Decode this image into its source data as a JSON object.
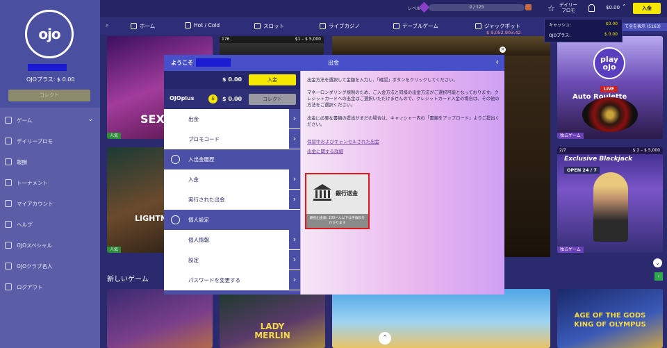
{
  "sidebar": {
    "logo": "ojo",
    "ojo_plus": "OJOプラス: $ 0.00",
    "collect": "コレクト",
    "items": [
      {
        "label": "ゲーム",
        "icon": "gamepad-icon"
      },
      {
        "label": "デイリープロモ",
        "icon": "star-icon"
      },
      {
        "label": "報酬",
        "icon": "gift-icon"
      },
      {
        "label": "トーナメント",
        "icon": "trophy-icon"
      },
      {
        "label": "マイアカウント",
        "icon": "user-icon"
      },
      {
        "label": "ヘルプ",
        "icon": "help-icon"
      },
      {
        "label": "OJOスペシャル",
        "icon": "special-icon"
      },
      {
        "label": "OJOクラブ名人",
        "icon": "crown-icon"
      },
      {
        "label": "ログアウト",
        "icon": "logout-icon"
      }
    ]
  },
  "topbar": {
    "level_label": "レベル",
    "level_progress": "0 / 125",
    "daily_promo": "デイリー\nプロモ",
    "balance": "$0.00",
    "deposit": "入金"
  },
  "catnav": {
    "items": [
      {
        "label": "ホーム",
        "icon": "home-icon"
      },
      {
        "label": "Hot / Cold",
        "icon": "snowflake-icon"
      },
      {
        "label": "スロット",
        "icon": "slot-icon"
      },
      {
        "label": "ライブカジノ",
        "icon": "dealer-icon"
      },
      {
        "label": "テーブルゲーム",
        "icon": "table-icon"
      },
      {
        "label": "ジャックポット",
        "icon": "jackpot-icon"
      }
    ],
    "jackpot_amount": "$ 9,052,903.42"
  },
  "cash_dropdown": {
    "cash_label": "キャッシュ:",
    "cash_value": "$0.00",
    "plus_label": "OJOプラス:",
    "plus_value": "$ 0.00",
    "show_all": "て全を表示 (5163)"
  },
  "games": {
    "g1_title": "SEX BACCA",
    "g1_tag": "人気",
    "g2_info_left": "176",
    "g2_info_right": "$1 – $ 5,000",
    "g3_title": "LIGHTN BACCA",
    "g3_tag": "人気",
    "g4_logo": "play\nojo",
    "g4_live": "LIVE",
    "g4_title": "Auto Roulette",
    "g4_tag": "独占ゲーム",
    "g5_info_left": "2/7",
    "g5_info_right": "$ 2 – $ 5,000",
    "g5_title": "Exclusive Blackjack",
    "g5_open": "OPEN 24 / 7",
    "g5_tag": "独占ゲーム",
    "g7_title": "LADY\nMERLIN",
    "g9_title": "AGE OF THE GODS\nKING OF OLYMPUS"
  },
  "new_games": "新しいゲーム",
  "modal": {
    "welcome": "ようこそ",
    "title": "出金",
    "cash": "$ 0.00",
    "deposit": "入金",
    "ojo_plus_logo": "OJOplus",
    "coin": "$",
    "plus_balance": "$ 0.00",
    "collect": "コレクト",
    "menu": [
      {
        "type": "row",
        "label": "出金"
      },
      {
        "type": "row",
        "label": "プロモコード"
      },
      {
        "type": "head",
        "label": "入出金履歴",
        "icon": "history-icon"
      },
      {
        "type": "row",
        "label": "入金"
      },
      {
        "type": "row",
        "label": "実行された出金"
      },
      {
        "type": "head",
        "label": "個人設定",
        "icon": "user-settings-icon"
      },
      {
        "type": "row",
        "label": "個人情報"
      },
      {
        "type": "row",
        "label": "設定"
      },
      {
        "type": "row",
        "label": "パスワードを変更する"
      }
    ],
    "instructions": [
      "出金方法を選択して金額を入力し、「確認」ボタンをクリックしてください。",
      "マネーロンダリング規制のため、ご入金方法と同様の出金方法がご選択可能となっております。クレジットカードへの出金はご選択いただけませんので、クレジットカード入金の場合は、その他の方法をご選択ください。",
      "出金に必要な書類の提出がまだの場合は、キャッシャー内の「書類をアップロード」よりご提出ください。"
    ],
    "link_pending": "保留中およびキャンセルされた出金",
    "link_details": "出金に関する詳細",
    "bank_label": "銀行送金",
    "bank_note": "最低出金額: 100ドル以下は手数料を\nかかります"
  }
}
